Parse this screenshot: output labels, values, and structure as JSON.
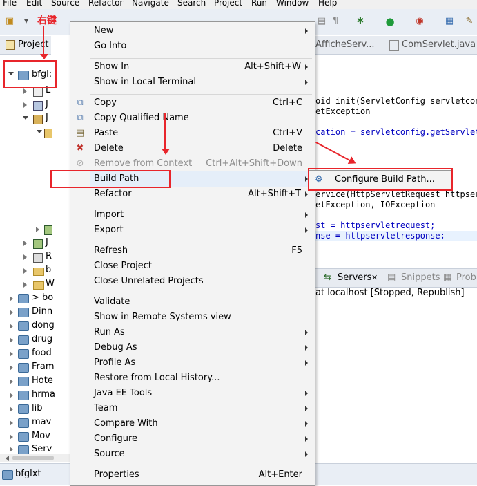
{
  "menubar": [
    "File",
    "Edit",
    "Source",
    "Refactor",
    "Navigate",
    "Search",
    "Project",
    "Run",
    "Window",
    "Help"
  ],
  "editor_tabs": [
    "AfficheServ...",
    "ComServlet.java"
  ],
  "code_lines": {
    "l1": "oid init(ServletConfig servletconf",
    "l2": "etException",
    "l3": "cation = servletconfig.getServletC",
    "l4": "ervice(HttpServletRequest httpservl",
    "l5": "etException, IOException",
    "l6": "st = httpservletrequest;",
    "l7": "nse = httpservletresponse;"
  },
  "servers_panel": {
    "tabs": [
      "Servers",
      "Snippets",
      "Probl"
    ],
    "server_entry": "at localhost  [Stopped, Republish]"
  },
  "project_explorer": {
    "header": "Project",
    "selected_project": "bfgl:",
    "items": [
      "L",
      "J",
      "J",
      "J",
      "R",
      "b",
      "W",
      "> bo",
      "Dinn",
      "dong",
      "drug",
      "food",
      "Fram",
      "Hote",
      "hrma",
      "lib",
      "mav",
      "Mov",
      "Serv"
    ]
  },
  "annotation": {
    "right_click_label": "右键"
  },
  "status": {
    "project": "bfglxt"
  },
  "context_menu": {
    "items": [
      {
        "label": "New",
        "shortcut": "",
        "submenu": true,
        "icon": ""
      },
      {
        "label": "Go Into",
        "shortcut": "",
        "submenu": false,
        "icon": ""
      },
      {
        "label": "Show In",
        "shortcut": "Alt+Shift+W",
        "submenu": true,
        "icon": ""
      },
      {
        "label": "Show in Local Terminal",
        "shortcut": "",
        "submenu": true,
        "icon": ""
      },
      {
        "label": "Copy",
        "shortcut": "Ctrl+C",
        "submenu": false,
        "icon": "copy-icon"
      },
      {
        "label": "Copy Qualified Name",
        "shortcut": "",
        "submenu": false,
        "icon": "copy-qualified-icon"
      },
      {
        "label": "Paste",
        "shortcut": "Ctrl+V",
        "submenu": false,
        "icon": "paste-icon"
      },
      {
        "label": "Delete",
        "shortcut": "Delete",
        "submenu": false,
        "icon": "delete-icon"
      },
      {
        "label": "Remove from Context",
        "shortcut": "Ctrl+Alt+Shift+Down",
        "submenu": false,
        "icon": "remove-context-icon",
        "disabled": true
      },
      {
        "label": "Build Path",
        "shortcut": "",
        "submenu": true,
        "icon": ""
      },
      {
        "label": "Refactor",
        "shortcut": "Alt+Shift+T",
        "submenu": true,
        "icon": ""
      },
      {
        "label": "Import",
        "shortcut": "",
        "submenu": true,
        "icon": ""
      },
      {
        "label": "Export",
        "shortcut": "",
        "submenu": true,
        "icon": ""
      },
      {
        "label": "Refresh",
        "shortcut": "F5",
        "submenu": false,
        "icon": ""
      },
      {
        "label": "Close Project",
        "shortcut": "",
        "submenu": false,
        "icon": ""
      },
      {
        "label": "Close Unrelated Projects",
        "shortcut": "",
        "submenu": false,
        "icon": ""
      },
      {
        "label": "Validate",
        "shortcut": "",
        "submenu": false,
        "icon": ""
      },
      {
        "label": "Show in Remote Systems view",
        "shortcut": "",
        "submenu": false,
        "icon": ""
      },
      {
        "label": "Run As",
        "shortcut": "",
        "submenu": true,
        "icon": ""
      },
      {
        "label": "Debug As",
        "shortcut": "",
        "submenu": true,
        "icon": ""
      },
      {
        "label": "Profile As",
        "shortcut": "",
        "submenu": true,
        "icon": ""
      },
      {
        "label": "Restore from Local History...",
        "shortcut": "",
        "submenu": false,
        "icon": ""
      },
      {
        "label": "Java EE Tools",
        "shortcut": "",
        "submenu": true,
        "icon": ""
      },
      {
        "label": "Team",
        "shortcut": "",
        "submenu": true,
        "icon": ""
      },
      {
        "label": "Compare With",
        "shortcut": "",
        "submenu": true,
        "icon": ""
      },
      {
        "label": "Configure",
        "shortcut": "",
        "submenu": true,
        "icon": ""
      },
      {
        "label": "Source",
        "shortcut": "",
        "submenu": true,
        "icon": ""
      },
      {
        "label": "Properties",
        "shortcut": "Alt+Enter",
        "submenu": false,
        "icon": ""
      }
    ]
  },
  "submenu": {
    "item": "Configure Build Path..."
  },
  "colors": {
    "annotation_red": "#e8252b",
    "menu_bg": "#f3f3f3",
    "highlight": "#e5eef9"
  }
}
